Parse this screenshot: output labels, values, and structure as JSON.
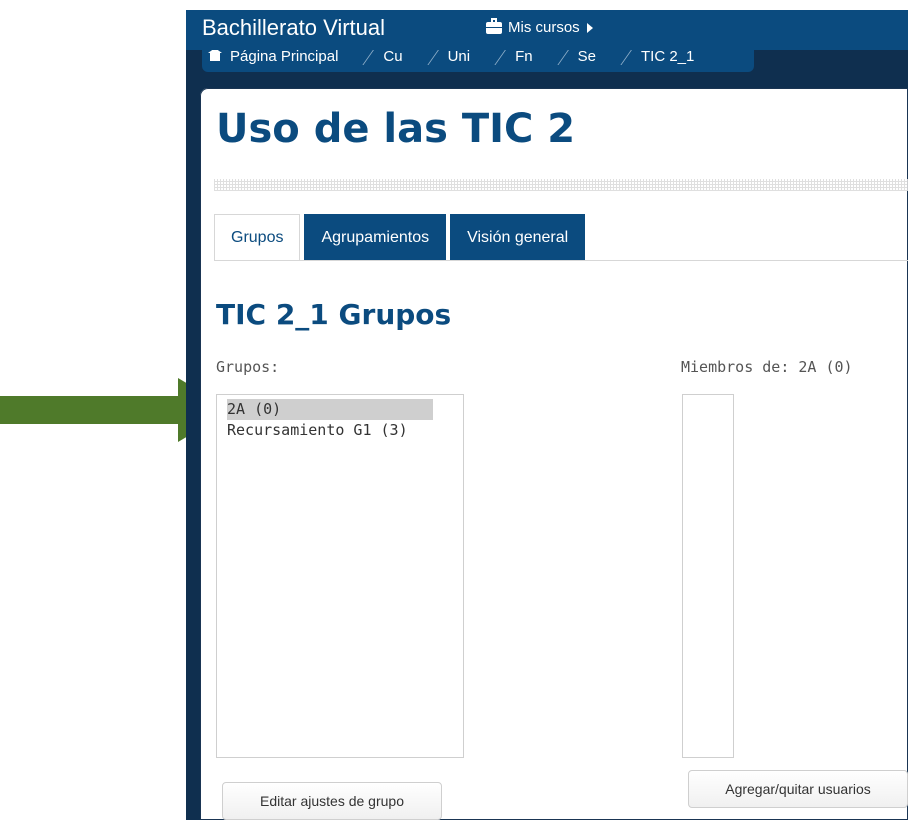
{
  "navbar": {
    "brand": "Bachillerato Virtual",
    "my_courses": "Mis cursos",
    "my_courses_icon": "briefcase-icon",
    "my_courses_caret_icon": "caret-right-icon"
  },
  "breadcrumb": {
    "items": [
      "Página Principal",
      "Cu",
      "Uni",
      "Fn",
      "Se",
      "TIC 2_1"
    ],
    "home_icon": "home-icon"
  },
  "page": {
    "title": "Uso de las TIC 2"
  },
  "tabs": [
    {
      "label": "Grupos",
      "active": true
    },
    {
      "label": "Agrupamientos",
      "active": false
    },
    {
      "label": "Visión general",
      "active": false
    }
  ],
  "groups_section": {
    "title": "TIC 2_1 Grupos",
    "groups_label": "Grupos:",
    "groups": [
      {
        "label": "2A (0)",
        "selected": true
      },
      {
        "label": "Recursamiento G1 (3)",
        "selected": false
      }
    ],
    "members_label": "Miembros de: 2A (0)",
    "edit_button": "Editar ajustes de grupo",
    "add_remove_button": "Agregar/quitar usuarios"
  },
  "annotation": {
    "arrow_color": "#4f7a2a"
  },
  "colors": {
    "brand_blue": "#0b4b7f",
    "nav_dark": "#0f2f4f"
  }
}
